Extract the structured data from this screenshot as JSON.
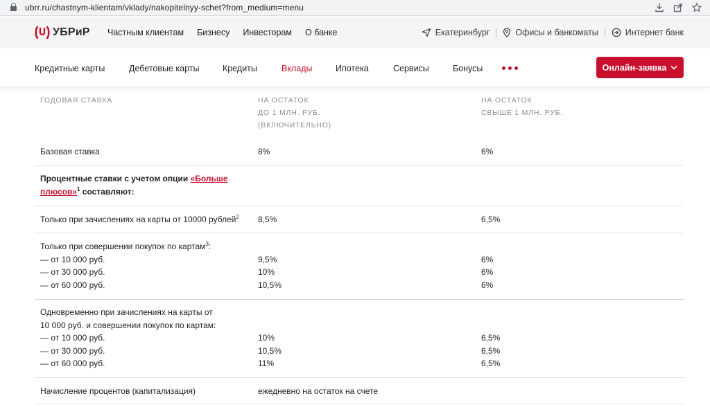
{
  "browser": {
    "url": "ubrr.ru/chastnym-klientam/vklady/nakopitelnyy-schet?from_medium=menu",
    "icons": [
      "lock-icon",
      "download-icon",
      "share-icon",
      "star-icon"
    ]
  },
  "site": {
    "logo": "УБРиР",
    "brand_color": "#c8102e",
    "top_nav": [
      "Частным клиентам",
      "Бизнесу",
      "Инвесторам",
      "О банке"
    ],
    "city": "Екатеринбург",
    "offices": "Офисы и банкоматы",
    "internet_bank": "Интернет банк"
  },
  "main_nav": {
    "items": [
      "Кредитные карты",
      "Дебетовые карты",
      "Кредиты",
      "Вклады",
      "Ипотека",
      "Сервисы",
      "Бонусы"
    ],
    "active": "Вклады",
    "cta": "Онлайн-заявка"
  },
  "table": {
    "headers": {
      "col1": "ГОДОВАЯ СТАВКА",
      "col2": [
        "НА ОСТАТОК",
        "ДО 1 МЛН. РУБ.",
        "(ВКЛЮЧИТЕЛЬНО)"
      ],
      "col3": [
        "НА ОСТАТОК",
        "СВЫШЕ 1 МЛН. РУБ."
      ]
    },
    "base": {
      "label": "Базовая ставка",
      "v1": "8%",
      "v2": "6%"
    },
    "option": {
      "prefix": "Процентные ставки с учетом опции ",
      "link_line1": "«Больше",
      "link_line2": "плюсов»",
      "sup": "1",
      "suffix": " составляют:"
    },
    "salary": {
      "label": "Только при зачислениях на карты от 10000 рублей",
      "sup": "2",
      "v1": "8,5%",
      "v2": "6,5%"
    },
    "purchases": {
      "label": "Только при совершении покупок по картам",
      "sup": "3",
      "suffix": ":",
      "rows": [
        {
          "label": "— от 10 000 руб.",
          "v1": "9,5%",
          "v2": "6%"
        },
        {
          "label": "— от 30 000 руб.",
          "v1": "10%",
          "v2": "6%"
        },
        {
          "label": "— от 60 000 руб.",
          "v1": "10,5%",
          "v2": "6%"
        }
      ]
    },
    "combined": {
      "line1": "Одновременно при зачислениях на карты от",
      "line2": "10 000 руб. и совершении покупок по картам:",
      "rows": [
        {
          "label": "— от 10 000 руб.",
          "v1": "10%",
          "v2": "6,5%"
        },
        {
          "label": "— от 30 000 руб.",
          "v1": "10,5%",
          "v2": "6,5%"
        },
        {
          "label": "— от 60 000 руб.",
          "v1": "11%",
          "v2": "6,5%"
        }
      ]
    },
    "capitalization": {
      "label": "Начисление процентов (капитализация)",
      "value": "ежедневно на остаток на счете"
    }
  }
}
